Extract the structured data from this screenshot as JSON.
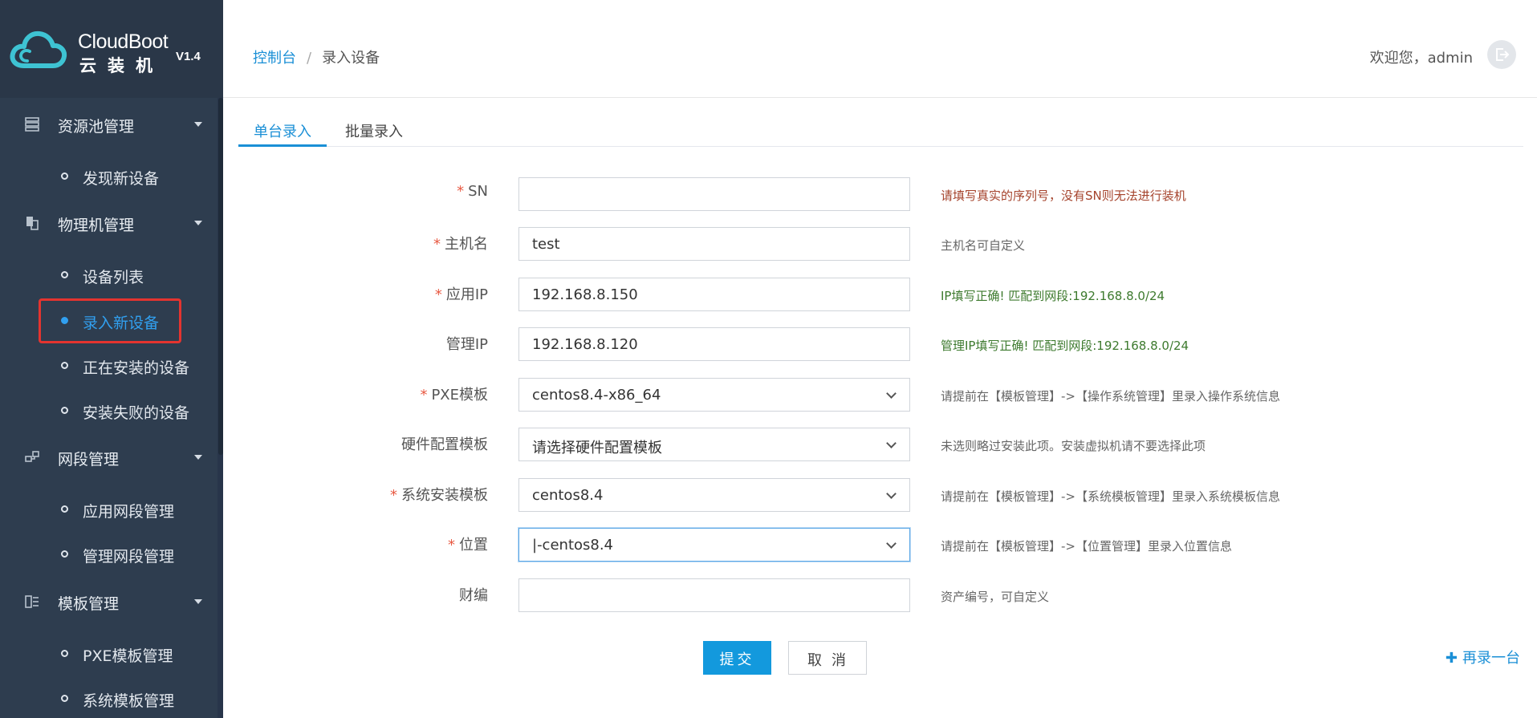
{
  "app": {
    "title": "CloudBoot",
    "subtitle": "云装机",
    "version": "V1.4"
  },
  "sidebar": {
    "groups": [
      {
        "label": "资源池管理",
        "icon": "server-icon"
      },
      {
        "label": "物理机管理",
        "icon": "machine-icon"
      },
      {
        "label": "网段管理",
        "icon": "network-icon"
      },
      {
        "label": "模板管理",
        "icon": "template-icon"
      }
    ],
    "items": [
      {
        "label": "发现新设备"
      },
      {
        "label": "设备列表"
      },
      {
        "label": "录入新设备",
        "active": true
      },
      {
        "label": "正在安装的设备"
      },
      {
        "label": "安装失败的设备"
      },
      {
        "label": "应用网段管理"
      },
      {
        "label": "管理网段管理"
      },
      {
        "label": "PXE模板管理"
      },
      {
        "label": "系统模板管理"
      }
    ]
  },
  "header": {
    "breadcrumb_home": "控制台",
    "breadcrumb_sep": "/",
    "breadcrumb_current": "录入设备",
    "welcome": "欢迎您，admin"
  },
  "tabs": [
    {
      "label": "单台录入",
      "active": true
    },
    {
      "label": "批量录入",
      "active": false
    }
  ],
  "form": {
    "required_mark": "*",
    "fields": [
      {
        "label": "SN",
        "required": true,
        "type": "text",
        "value": "",
        "hint": "请填写真实的序列号，没有SN则无法进行装机",
        "hint_type": "error"
      },
      {
        "label": "主机名",
        "required": true,
        "type": "text",
        "value": "test",
        "hint": "主机名可自定义",
        "hint_type": "normal"
      },
      {
        "label": "应用IP",
        "required": true,
        "type": "text",
        "value": "192.168.8.150",
        "hint": "IP填写正确!   匹配到网段:192.168.8.0/24",
        "hint_type": "ok"
      },
      {
        "label": "管理IP",
        "required": false,
        "type": "text",
        "value": "192.168.8.120",
        "hint": "管理IP填写正确!   匹配到网段:192.168.8.0/24",
        "hint_type": "ok"
      },
      {
        "label": "PXE模板",
        "required": true,
        "type": "select",
        "value": "centos8.4-x86_64",
        "hint": "请提前在【模板管理】->【操作系统管理】里录入操作系统信息",
        "hint_type": "normal"
      },
      {
        "label": "硬件配置模板",
        "required": false,
        "type": "select",
        "value": "请选择硬件配置模板",
        "hint": "未选则略过安装此项。安装虚拟机请不要选择此项",
        "hint_type": "normal"
      },
      {
        "label": "系统安装模板",
        "required": true,
        "type": "select",
        "value": "centos8.4",
        "hint": "请提前在【模板管理】->【系统模板管理】里录入系统模板信息",
        "hint_type": "normal"
      },
      {
        "label": "位置",
        "required": true,
        "type": "select",
        "value": "|-centos8.4",
        "hint": "请提前在【模板管理】->【位置管理】里录入位置信息",
        "hint_type": "normal",
        "focused": true
      },
      {
        "label": "财编",
        "required": false,
        "type": "text",
        "value": "",
        "hint": "资产编号，可自定义",
        "hint_type": "normal"
      }
    ],
    "submit_label": "提交",
    "cancel_label": "取消",
    "again_label": "再录一台"
  },
  "colors": {
    "sidebar_bg": "#2e3d4f",
    "accent": "#1a8fd6",
    "active_menu": "#31a0f0",
    "error_hint": "#a5432c",
    "ok_hint": "#3d7a2e",
    "required": "#e85a43"
  }
}
